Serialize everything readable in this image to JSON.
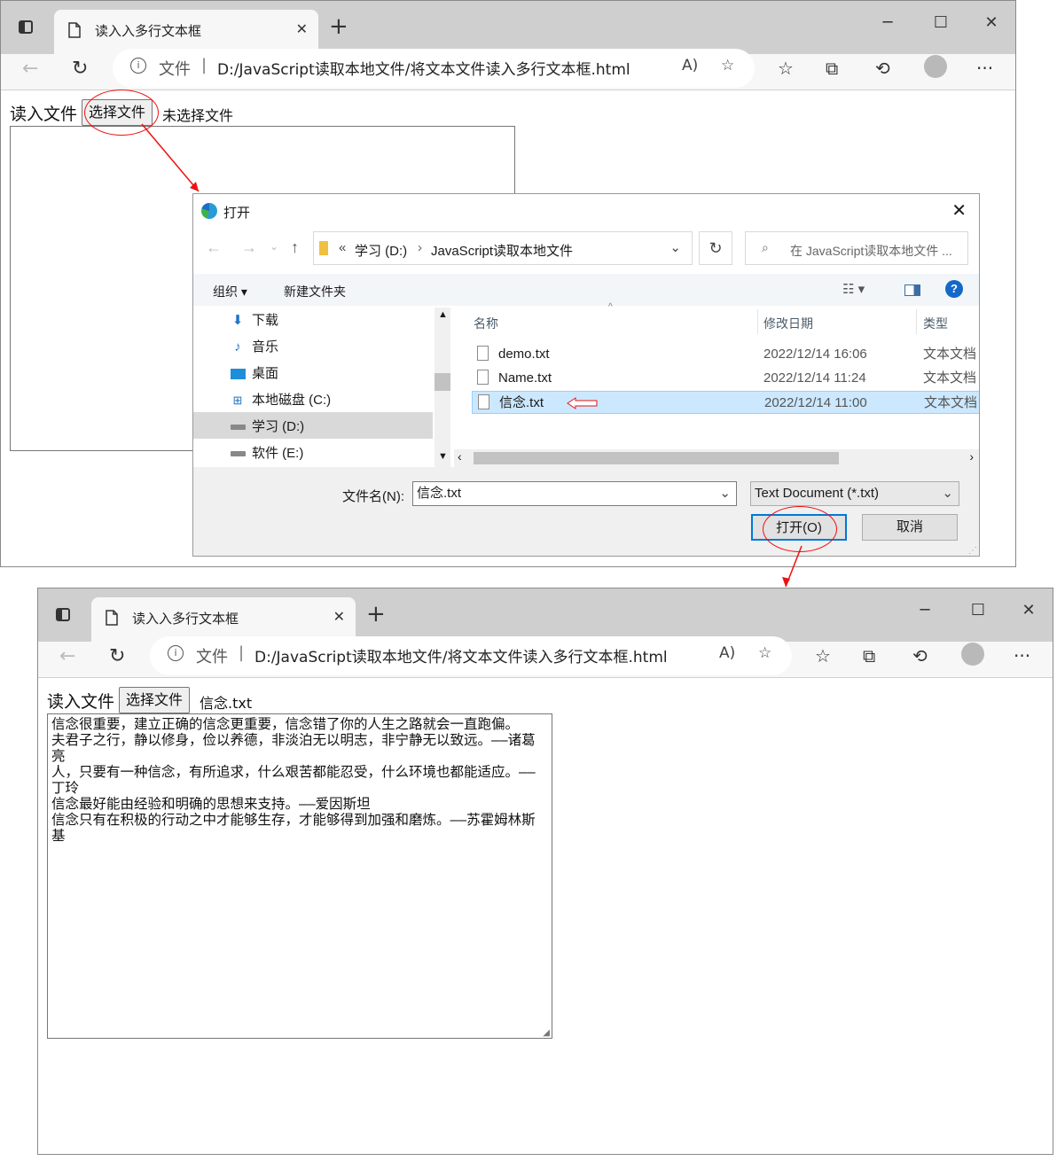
{
  "browser_top": {
    "tab_title": "读入入多行文本框",
    "tab_close": "✕",
    "new_tab": "+",
    "controls": {
      "minimize": "─",
      "maximize": "☐",
      "close": "✕"
    },
    "address_label": "文件",
    "address_sep": "|",
    "url": "D:/JavaScript读取本地文件/将文本文件读入多行文本框.html",
    "page": {
      "label": "读入文件",
      "button": "选择文件",
      "status": "未选择文件"
    }
  },
  "dialog": {
    "title": "打开",
    "close": "✕",
    "path": {
      "prefix": "«",
      "segments": [
        "学习 (D:)",
        "JavaScript读取本地文件"
      ],
      "separator": "›"
    },
    "search_placeholder": "在 JavaScript读取本地文件 ...",
    "toolbar": {
      "organize": "组织 ▾",
      "new_folder": "新建文件夹"
    },
    "nav_items": [
      {
        "icon": "download-icon",
        "label": "下载"
      },
      {
        "icon": "music-icon",
        "label": "音乐"
      },
      {
        "icon": "desktop-icon",
        "label": "桌面"
      },
      {
        "icon": "drive-icon",
        "label": "本地磁盘 (C:)"
      },
      {
        "icon": "drive-icon",
        "label": "学习 (D:)",
        "selected": true
      },
      {
        "icon": "drive-icon",
        "label": "软件 (E:)"
      }
    ],
    "columns": {
      "name": "名称",
      "date": "修改日期",
      "type": "类型"
    },
    "files": [
      {
        "name": "demo.txt",
        "date": "2022/12/14 16:06",
        "type": "文本文档"
      },
      {
        "name": "Name.txt",
        "date": "2022/12/14 11:24",
        "type": "文本文档"
      },
      {
        "name": "信念.txt",
        "date": "2022/12/14 11:00",
        "type": "文本文档",
        "selected": true
      }
    ],
    "filename_label": "文件名(N):",
    "filename_value": "信念.txt",
    "filetype_value": "Text Document (*.txt)",
    "open_button": "打开(O)",
    "cancel_button": "取消"
  },
  "browser_bottom": {
    "tab_title": "读入入多行文本框",
    "tab_close": "✕",
    "new_tab": "+",
    "controls": {
      "minimize": "─",
      "maximize": "☐",
      "close": "✕"
    },
    "address_label": "文件",
    "address_sep": "|",
    "url": "D:/JavaScript读取本地文件/将文本文件读入多行文本框.html",
    "page": {
      "label": "读入文件",
      "button": "选择文件",
      "status": "信念.txt",
      "textarea": "信念很重要，建立正确的信念更重要，信念错了你的人生之路就会一直跑偏。\n夫君子之行，静以修身，俭以养德，非淡泊无以明志，非宁静无以致远。——诸葛亮\n人，只要有一种信念，有所追求，什么艰苦都能忍受，什么环境也都能适应。——丁玲\n信念最好能由经验和明确的思想来支持。——爱因斯坦\n信念只有在积极的行动之中才能够生存，才能够得到加强和磨炼。——苏霍姆林斯基"
    }
  },
  "colors": {
    "annotation": "#e11111",
    "selection": "#cce8ff",
    "tabbar": "#cfcfcf"
  }
}
